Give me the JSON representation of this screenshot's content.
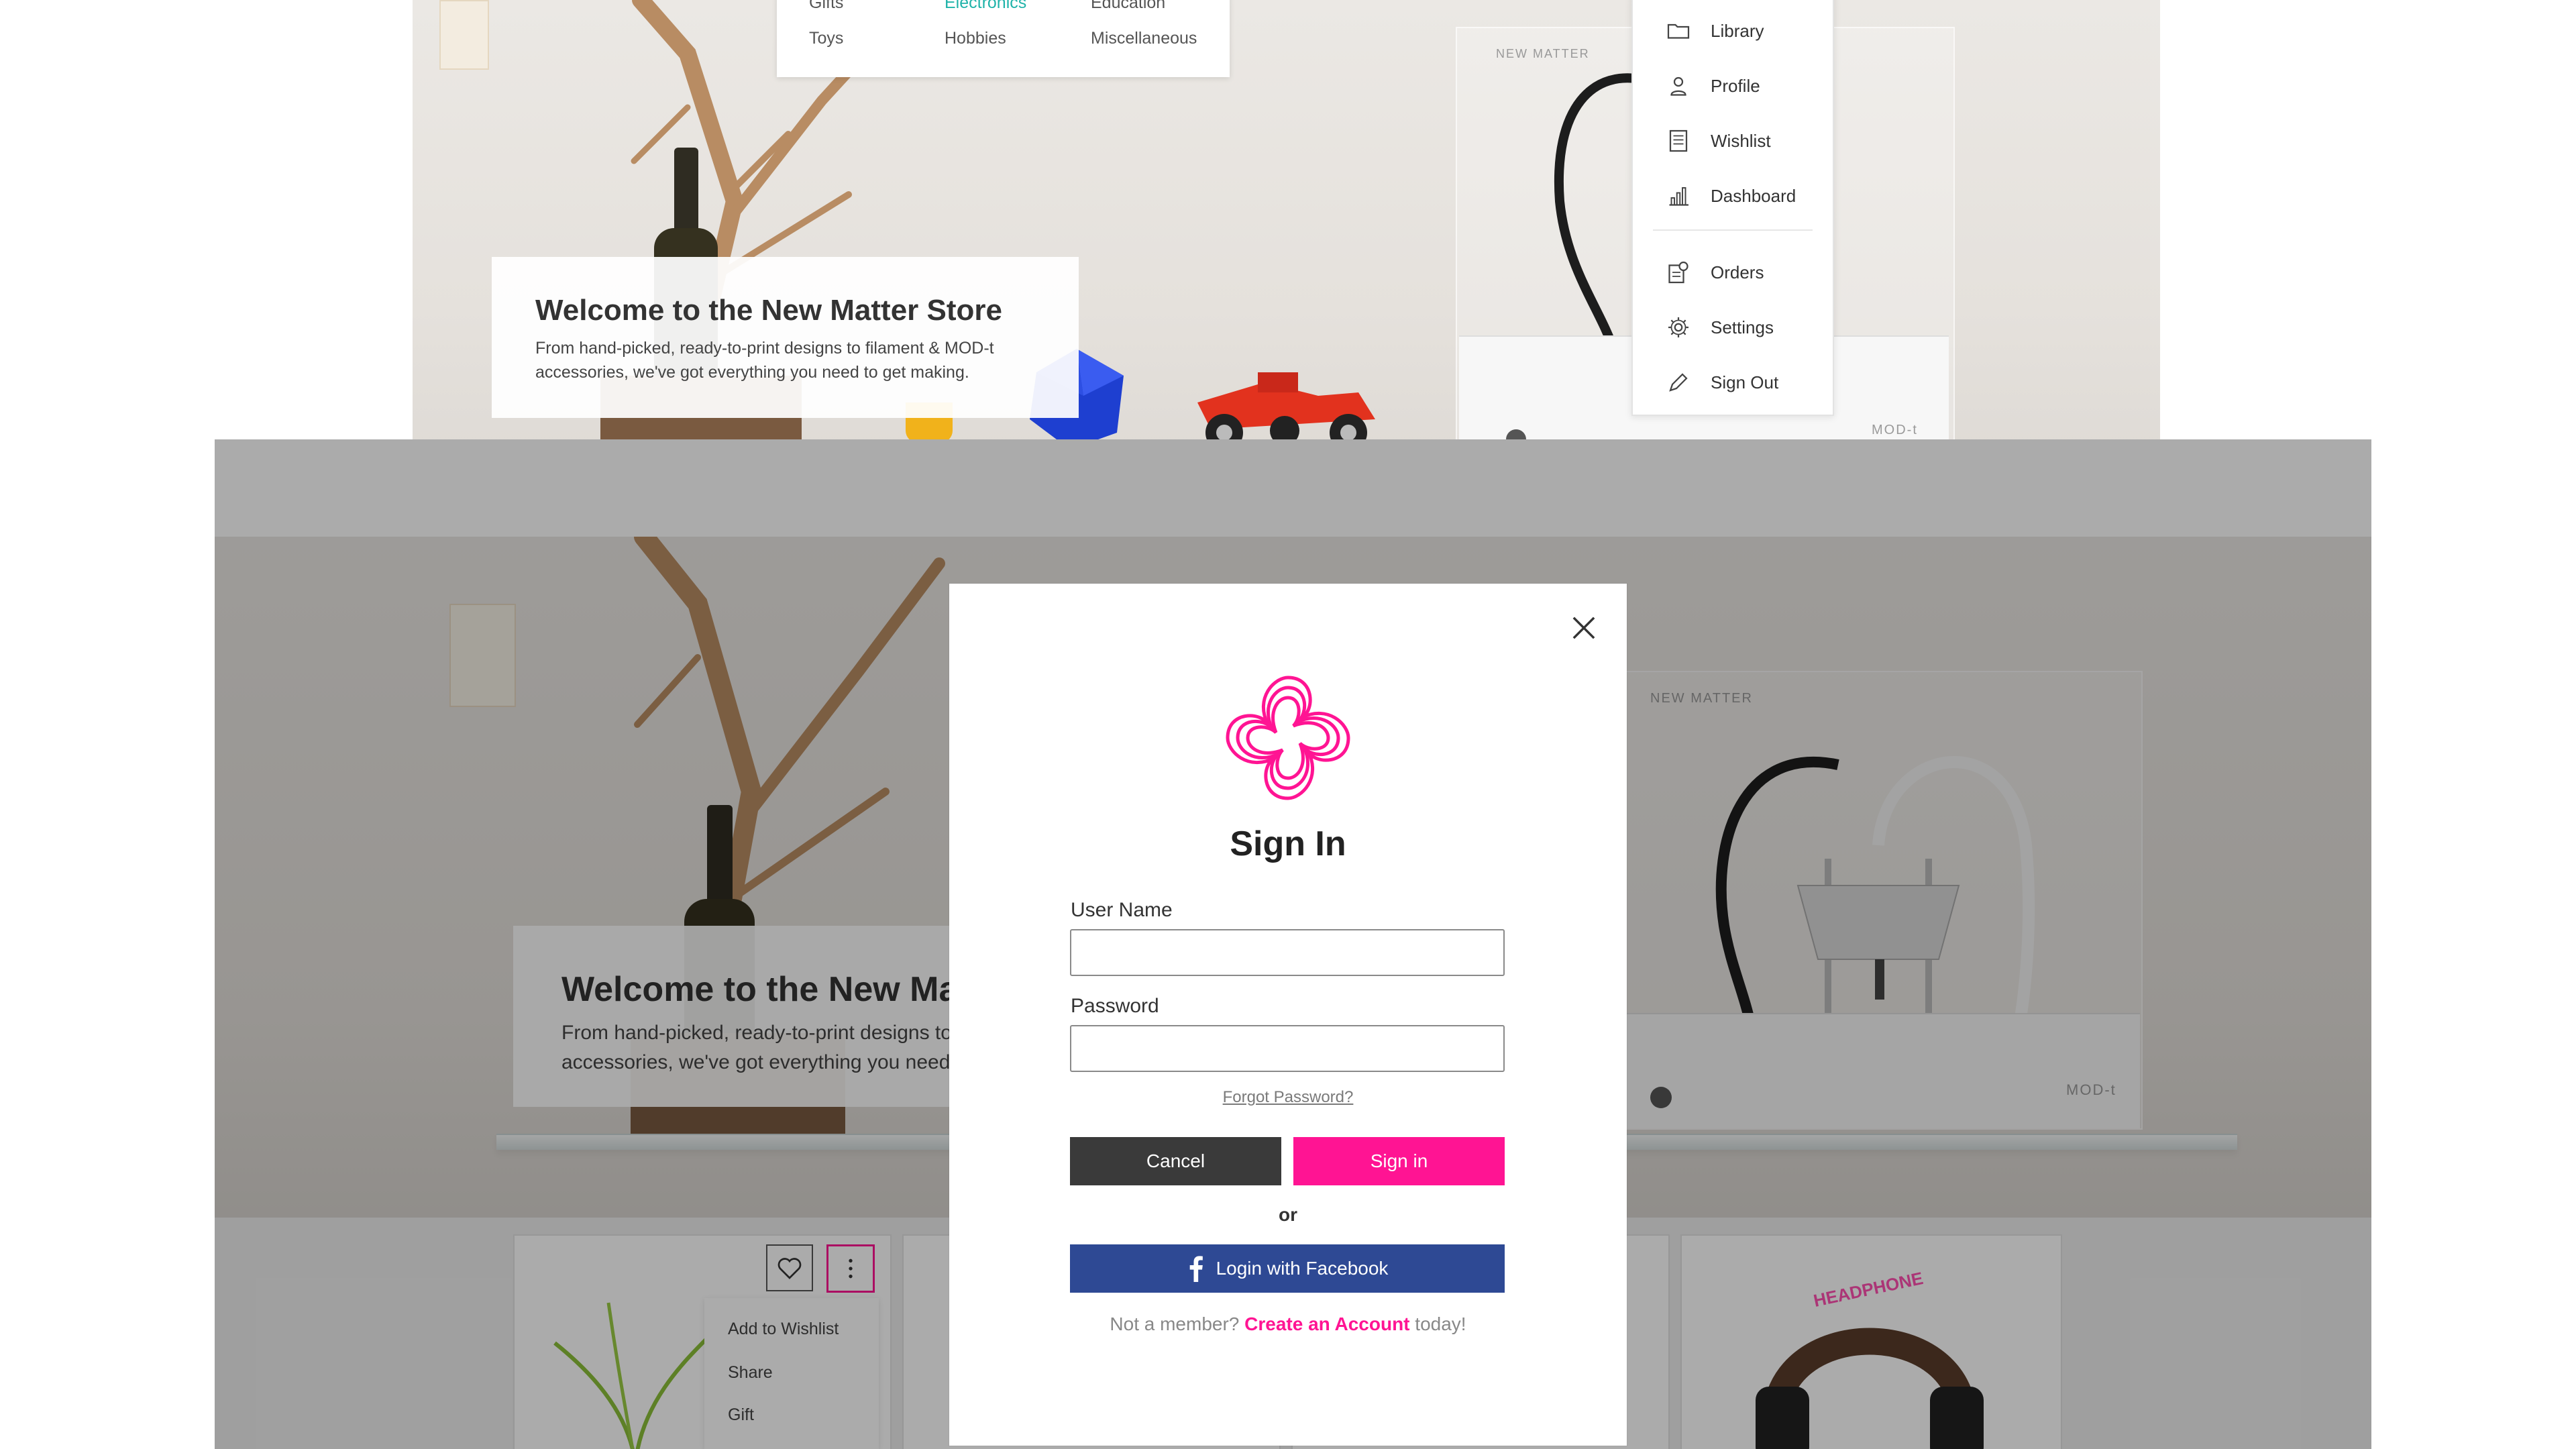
{
  "colors": {
    "brand_pink": "#ff1493",
    "facebook_blue": "#2e4994",
    "cancel_dark": "#3a3a3a",
    "teal": "#1fb3a9"
  },
  "top_screen": {
    "category_menu": {
      "partial_row": [
        "Gifts",
        "Electronics",
        "Education"
      ],
      "row": [
        "Toys",
        "Hobbies",
        "Miscellaneous"
      ]
    },
    "welcome": {
      "title": "Welcome to the New Matter Store",
      "body": "From hand-picked, ready-to-print designs to filament & MOD-t accessories, we've got everything you need to get making."
    },
    "printer_brand": "NEW MATTER",
    "printer_model": "MOD-t",
    "account_menu": {
      "items": [
        {
          "label": "Library",
          "icon": "folder-icon"
        },
        {
          "label": "Profile",
          "icon": "user-icon"
        },
        {
          "label": "Wishlist",
          "icon": "list-icon"
        },
        {
          "label": "Dashboard",
          "icon": "bar-chart-icon"
        },
        {
          "label": "Orders",
          "icon": "orders-icon"
        },
        {
          "label": "Settings",
          "icon": "gear-icon"
        },
        {
          "label": "Sign Out",
          "icon": "pencil-icon"
        }
      ]
    }
  },
  "bottom_screen": {
    "welcome": {
      "title": "Welcome to the New Matter Store",
      "body_line1": "From hand-picked, ready-to-print designs to filament & MOD-t",
      "body_line2": "accessories, we've got everything you need to get making."
    },
    "printer_brand": "NEW MATTER",
    "printer_model": "MOD-t",
    "product_card": {
      "wishlist_icon": "heart-icon",
      "more_icon": "more-vertical-icon",
      "context_menu": [
        "Add to Wishlist",
        "Share",
        "Gift"
      ]
    },
    "headphone_text": "HEADPHONE"
  },
  "modal": {
    "title": "Sign In",
    "logo_icon": "new-matter-logo-icon",
    "close_icon": "close-icon",
    "username_label": "User Name",
    "username_value": "",
    "password_label": "Password",
    "password_value": "",
    "forgot_link": "Forgot Password?",
    "cancel_label": "Cancel",
    "signin_label": "Sign in",
    "or_text": "or",
    "facebook_label": "Login with Facebook",
    "facebook_icon": "facebook-icon",
    "not_member_text": "Not a member?",
    "create_account_link": "Create an Account",
    "today_text": "today!"
  }
}
